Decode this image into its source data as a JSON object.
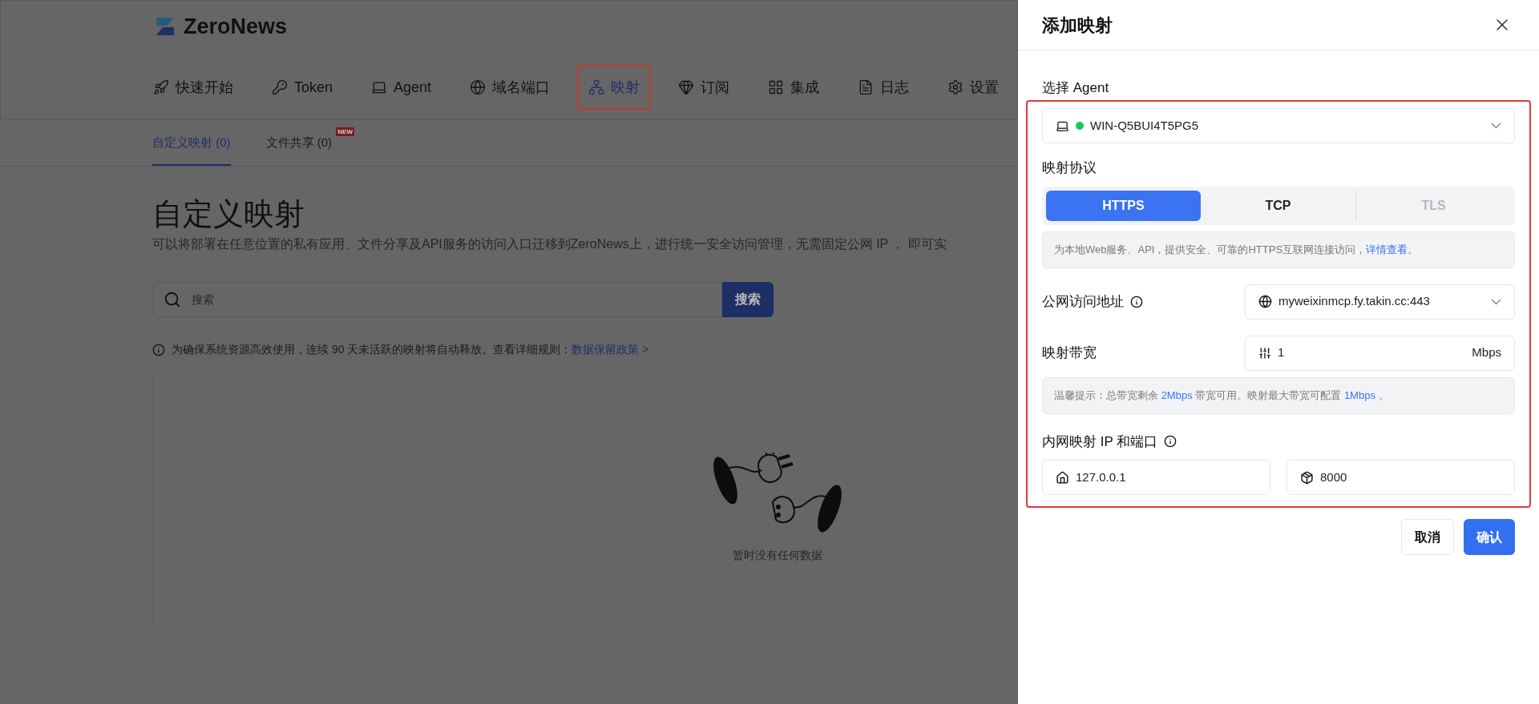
{
  "logo": {
    "text": "ZeroNews"
  },
  "nav": [
    {
      "label": "快速开始",
      "selected": false
    },
    {
      "label": "Token",
      "selected": false
    },
    {
      "label": "Agent",
      "selected": false
    },
    {
      "label": "域名端口",
      "selected": false
    },
    {
      "label": "映射",
      "selected": true
    },
    {
      "label": "订阅",
      "selected": false
    },
    {
      "label": "集成",
      "selected": false
    },
    {
      "label": "日志",
      "selected": false
    },
    {
      "label": "设置",
      "selected": false
    }
  ],
  "subtabs": [
    {
      "label": "自定义映射 (0)",
      "selected": true
    },
    {
      "label": "文件共享 (0)",
      "selected": false,
      "badge": "NEW"
    }
  ],
  "page": {
    "title": "自定义映射",
    "description": "可以将部署在任意位置的私有应用、文件分享及API服务的访问入口迁移到ZeroNews上，进行统一安全访问管理，无需固定公网 IP ， 即可实",
    "search": {
      "placeholder": "搜索",
      "button": "搜索"
    },
    "notice": {
      "text": "为确保系统资源高效使用，连续 90 天未活跃的映射将自动释放。查看详细规则：",
      "link": "数据保留政策 >"
    },
    "empty": "暂时没有任何数据"
  },
  "drawer": {
    "title": "添加映射",
    "agent": {
      "label": "选择 Agent",
      "value": "WIN-Q5BUI4T5PG5"
    },
    "protocol": {
      "label": "映射协议",
      "options": [
        {
          "label": "HTTPS",
          "selected": true,
          "disabled": false
        },
        {
          "label": "TCP",
          "selected": false,
          "disabled": false
        },
        {
          "label": "TLS",
          "selected": false,
          "disabled": true
        }
      ],
      "info": "为本地Web服务、API，提供安全、可靠的HTTPS互联网连接访问，",
      "info_link": "详情查看",
      "info_end": "。"
    },
    "address": {
      "label": "公网访问地址",
      "value": "myweixinmcp.fy.takin.cc:443"
    },
    "bandwidth": {
      "label": "映射带宽",
      "value": "1",
      "unit": "Mbps",
      "tip": {
        "before": "温馨提示：总带宽剩余 ",
        "remaining": "2Mbps",
        "middle": " 带宽可用。映射最大带宽可配置 ",
        "max": "1Mbps",
        "end": " 。"
      }
    },
    "local": {
      "label": "内网映射 IP 和端口",
      "ip": "127.0.0.1",
      "port": "8000"
    },
    "buttons": {
      "cancel": "取消",
      "confirm": "确认"
    }
  }
}
